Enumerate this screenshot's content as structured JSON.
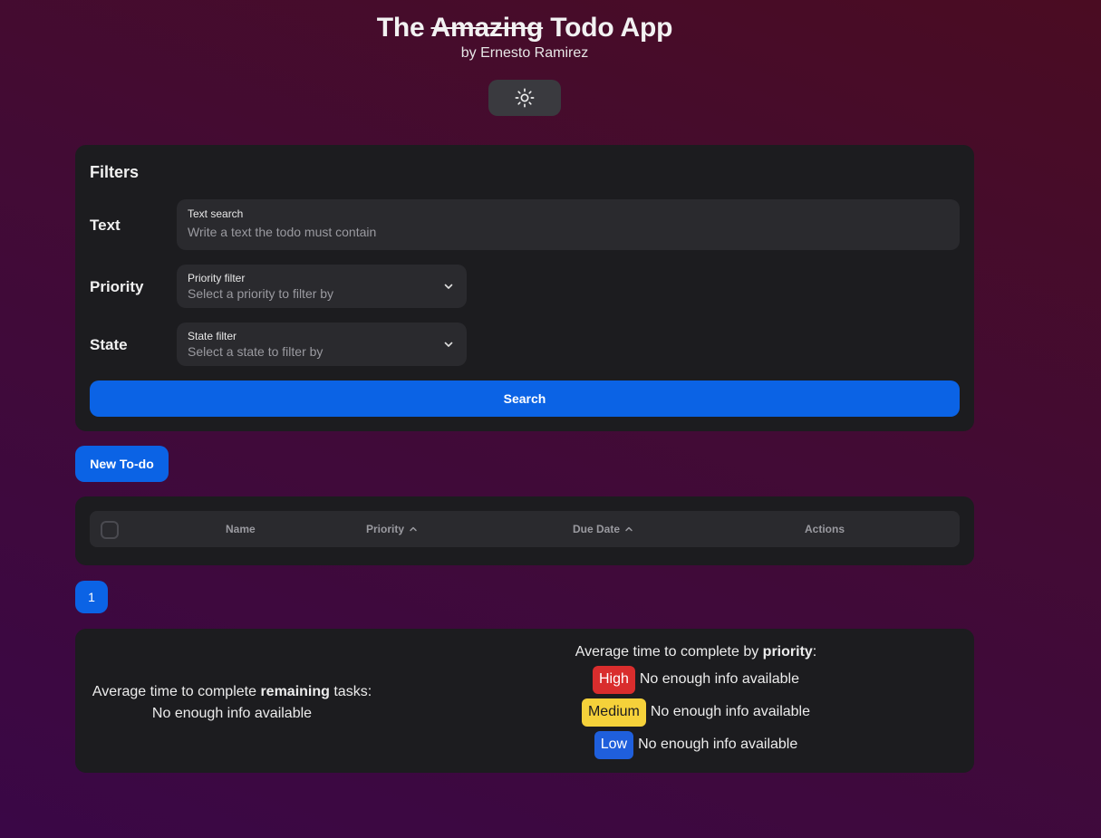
{
  "header": {
    "title_pre": "The",
    "title_strike": "Amazing",
    "title_post": "Todo App",
    "subtitle": "by Ernesto Ramirez",
    "theme_icon": "sun-icon"
  },
  "filters": {
    "heading": "Filters",
    "text": {
      "row_label": "Text",
      "label": "Text search",
      "placeholder": "Write a text the todo must contain"
    },
    "priority": {
      "row_label": "Priority",
      "label": "Priority filter",
      "placeholder": "Select a priority to filter by"
    },
    "state": {
      "row_label": "State",
      "label": "State filter",
      "placeholder": "Select a state to filter by"
    },
    "search_label": "Search"
  },
  "new_todo_label": "New To-do",
  "table": {
    "columns": [
      "Name",
      "Priority",
      "Due Date",
      "Actions"
    ]
  },
  "pagination": {
    "current_page": "1"
  },
  "stats": {
    "remaining_prefix": "Average time to complete ",
    "remaining_bold": "remaining",
    "remaining_suffix": " tasks:",
    "remaining_value": "No enough info available",
    "priority_prefix": "Average time to complete by ",
    "priority_bold": "priority",
    "priority_suffix": ":",
    "priorities": [
      {
        "label": "High",
        "value": "No enough info available",
        "color": "#d92d2d",
        "text_color": "#ffffff"
      },
      {
        "label": "Medium",
        "value": "No enough info available",
        "color": "#f5d13a",
        "text_color": "#1c1c1f"
      },
      {
        "label": "Low",
        "value": "No enough info available",
        "color": "#1f5fdc",
        "text_color": "#ffffff"
      }
    ]
  },
  "colors": {
    "accent": "#0b63e5",
    "card": "#1c1c1f",
    "field": "#2a2a2e"
  }
}
